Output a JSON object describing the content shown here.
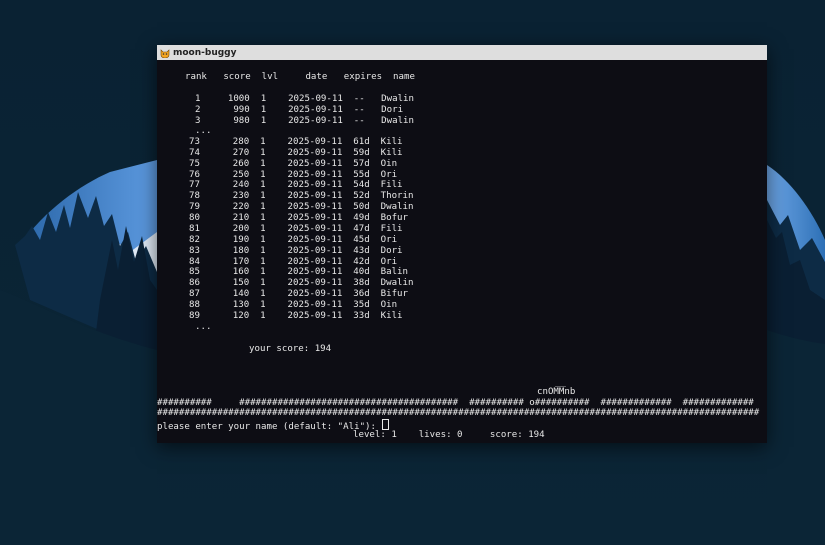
{
  "window": {
    "title": "moon-buggy",
    "icon": "cat-face-icon"
  },
  "scores": {
    "header": "rank   score  lvl     date   expires  name",
    "top_rows": [
      "1     1000  1    2025-09-11  --   Dwalin",
      "2      990  1    2025-09-11  --   Dori",
      "3      980  1    2025-09-11  --   Dwalin"
    ],
    "ellipsis": "...",
    "rows": [
      "73      280  1    2025-09-11  61d  Kili",
      "74      270  1    2025-09-11  59d  Kili",
      "75      260  1    2025-09-11  57d  Oin",
      "76      250  1    2025-09-11  55d  Ori",
      "77      240  1    2025-09-11  54d  Fili",
      "78      230  1    2025-09-11  52d  Thorin",
      "79      220  1    2025-09-11  50d  Dwalin",
      "80      210  1    2025-09-11  49d  Bofur",
      "81      200  1    2025-09-11  47d  Fili",
      "82      190  1    2025-09-11  45d  Ori",
      "83      180  1    2025-09-11  43d  Dori",
      "84      170  1    2025-09-11  42d  Ori",
      "85      160  1    2025-09-11  40d  Balin",
      "86      150  1    2025-09-11  38d  Dwalin",
      "87      140  1    2025-09-11  36d  Bifur",
      "88      130  1    2025-09-11  35d  Oin",
      "89      120  1    2025-09-11  33d  Kili"
    ],
    "ellipsis_bottom": "...",
    "your_score": "your score: 194"
  },
  "game": {
    "buggy_top": "__",
    "buggy": "cnOMMnb",
    "ground_1": "##########     ########################################  ########## o##########  #############  #############",
    "ground_2": "##############################################################################################################"
  },
  "prompt": "please enter your name (default: \"Ali\"): ",
  "status": "level: 1    lives: 0     score: 194"
}
